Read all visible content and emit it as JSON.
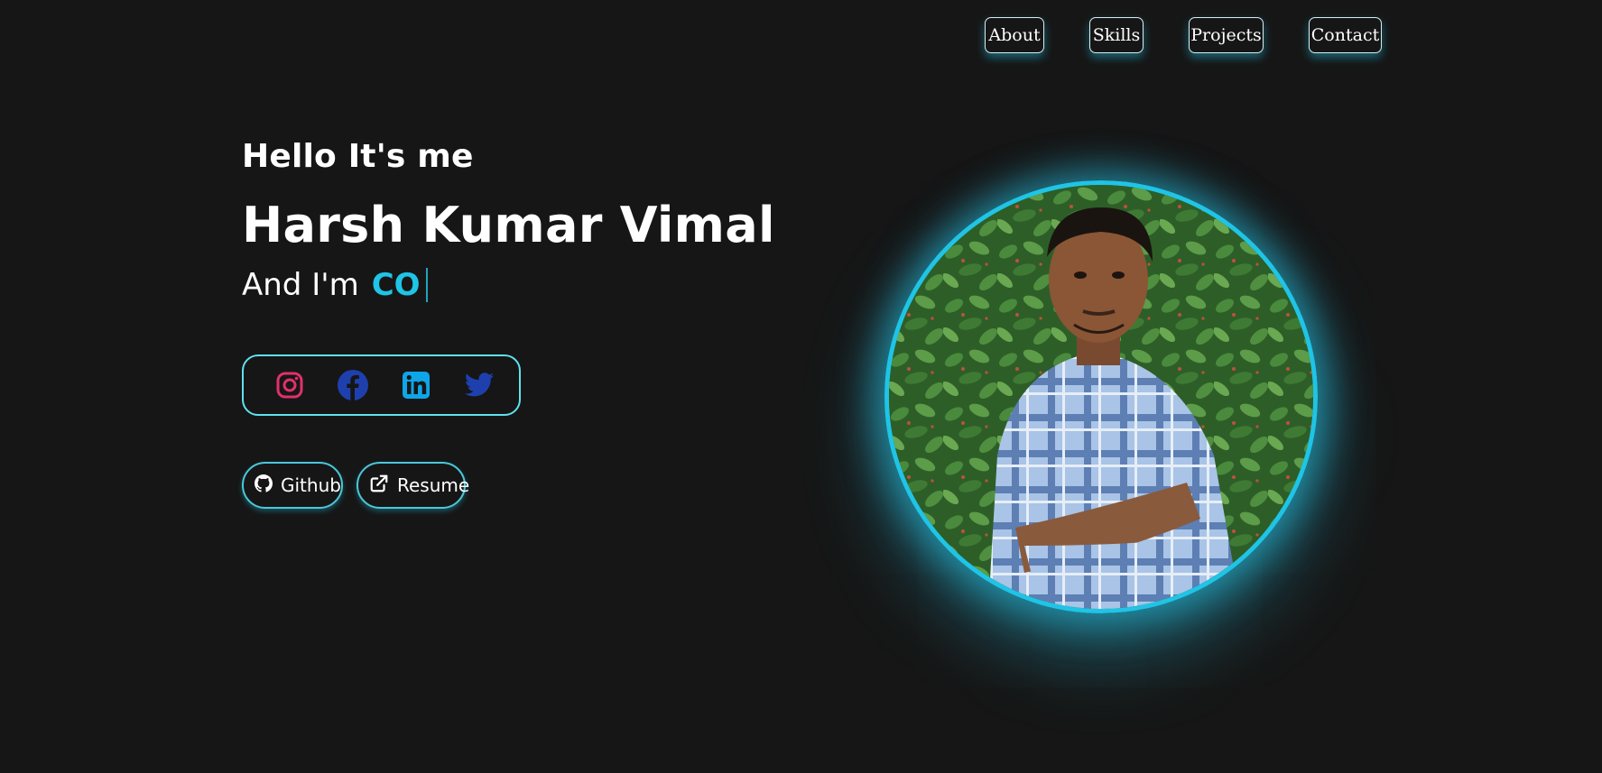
{
  "nav": {
    "items": [
      {
        "label": "About"
      },
      {
        "label": "Skills"
      },
      {
        "label": "Projects"
      },
      {
        "label": "Contact"
      }
    ]
  },
  "hero": {
    "greeting": "Hello It's me",
    "name": "Harsh Kumar Vimal",
    "role_prefix": "And I'm",
    "role_typed": "CO"
  },
  "social": {
    "icons": [
      "instagram-icon",
      "facebook-icon",
      "linkedin-icon",
      "twitter-icon"
    ],
    "colors": {
      "instagram": "#e1306c",
      "facebook": "#1e40af",
      "linkedin": "#0ea5e9",
      "twitter": "#1e40af"
    }
  },
  "buttons": {
    "github_label": "Github",
    "resume_label": "Resume"
  },
  "theme": {
    "background": "#161616",
    "accent": "#1fc4e6"
  }
}
